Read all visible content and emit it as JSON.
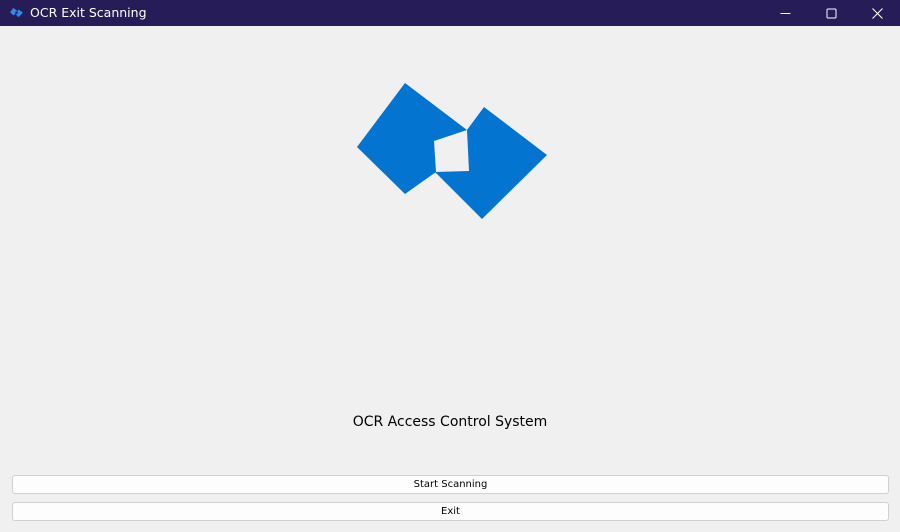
{
  "window": {
    "title": "OCR Exit Scanning",
    "app_icon": "blue-diamond-logo-icon",
    "controls": {
      "minimize_icon": "minimize-icon",
      "maximize_icon": "maximize-icon",
      "close_icon": "close-icon"
    }
  },
  "main": {
    "logo_icon": "blue-diamond-logo",
    "heading": "OCR Access Control System",
    "start_button_label": "Start Scanning",
    "exit_button_label": "Exit"
  },
  "colors": {
    "titlebar": "#261d58",
    "logo_blue": "#0374d0",
    "background": "#f0f0f0"
  }
}
